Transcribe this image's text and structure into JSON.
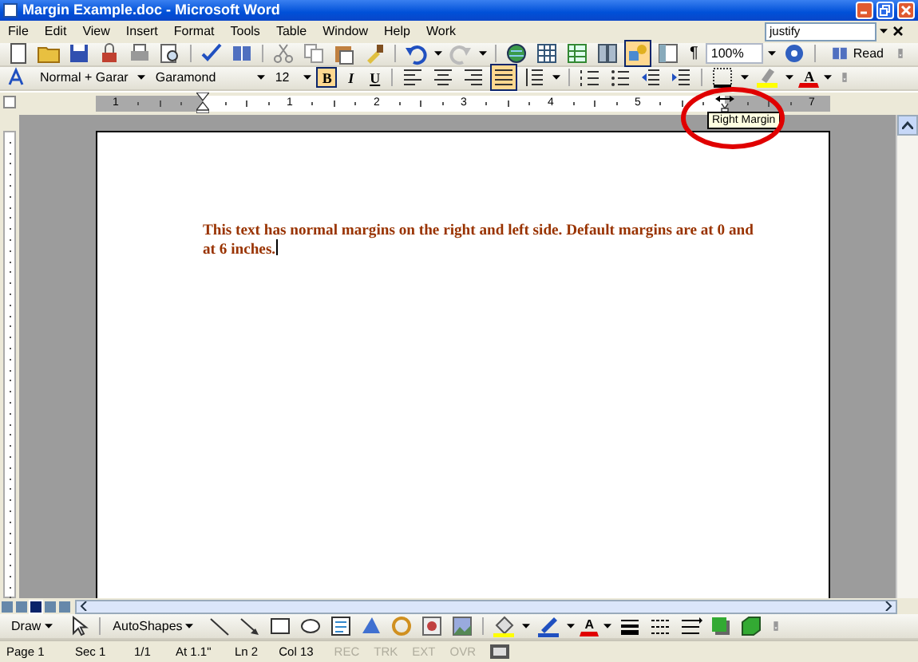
{
  "window": {
    "title": "Margin Example.doc - Microsoft Word"
  },
  "menu": {
    "items": [
      "File",
      "Edit",
      "View",
      "Insert",
      "Format",
      "Tools",
      "Table",
      "Window",
      "Help",
      "Work"
    ],
    "help_query": "justify"
  },
  "standard_toolbar": {
    "drawing_toggle_on": true,
    "show_hide": "¶",
    "zoom": "100%",
    "read_button": "Read"
  },
  "formatting_toolbar": {
    "style": "Normal + Garar",
    "font": "Garamond",
    "size": "12",
    "text_buttons": [
      {
        "label": "B",
        "selected": true
      },
      {
        "label": "I",
        "selected": false
      },
      {
        "label": "U",
        "selected": false
      }
    ],
    "alignment_buttons": [
      {
        "selected": false
      },
      {
        "selected": false
      },
      {
        "selected": false
      },
      {
        "selected": true
      }
    ],
    "font_color_label": "A"
  },
  "ruler": {
    "labels": [
      "1",
      "1",
      "2",
      "3",
      "4",
      "5",
      "7"
    ],
    "tooltip": "Right Margin"
  },
  "document": {
    "paragraph": "This text has normal margins on the right and left side. Default margins are at 0 and at 6 inches."
  },
  "drawing_toolbar": {
    "draw_menu": "Draw",
    "autoshapes_menu": "AutoShapes",
    "font_color_label": "A"
  },
  "status_bar": [
    {
      "text": "Page 1",
      "disabled": false
    },
    {
      "text": "Sec 1",
      "disabled": false
    },
    {
      "text": "1/1",
      "disabled": false
    },
    {
      "text": "At 1.1\"",
      "disabled": false
    },
    {
      "text": "Ln 2",
      "disabled": false
    },
    {
      "text": "Col 13",
      "disabled": false
    },
    {
      "text": "REC",
      "disabled": true
    },
    {
      "text": "TRK",
      "disabled": true
    },
    {
      "text": "EXT",
      "disabled": true
    },
    {
      "text": "OVR",
      "disabled": true
    }
  ]
}
